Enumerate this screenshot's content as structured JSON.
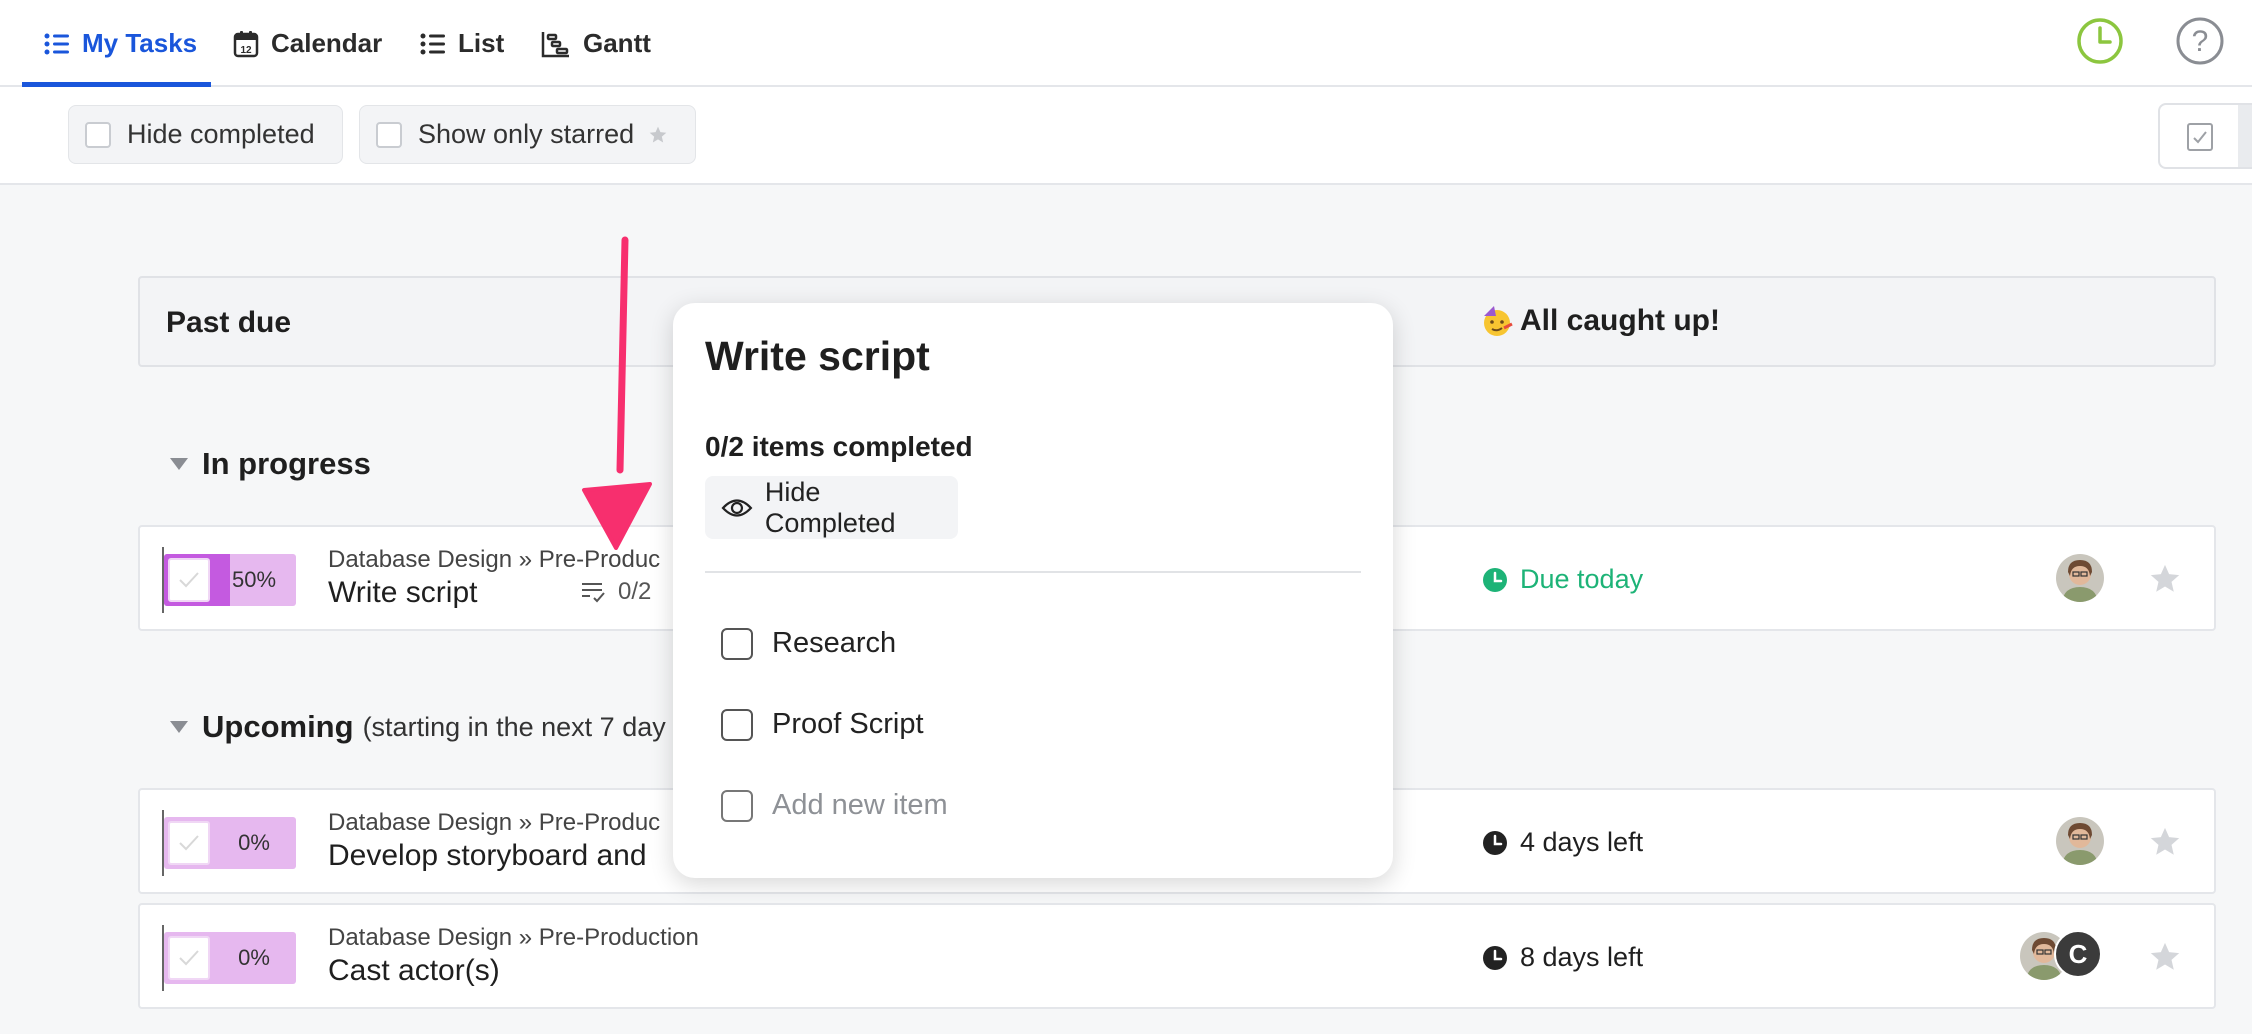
{
  "nav": {
    "tabs": [
      {
        "label": "My Tasks",
        "icon": "list-icon",
        "active": true
      },
      {
        "label": "Calendar",
        "icon": "calendar-icon"
      },
      {
        "label": "List",
        "icon": "list-icon"
      },
      {
        "label": "Gantt",
        "icon": "gantt-icon"
      }
    ],
    "calendar_icon_day": "12",
    "accent": "#1a56db",
    "clock_color": "#8cc63f"
  },
  "filters": {
    "hide_completed": "Hide completed",
    "show_only_starred": "Show only starred"
  },
  "past_due": {
    "title": "Past due",
    "status": "All caught up!"
  },
  "sections": {
    "in_progress": {
      "title": "In progress"
    },
    "upcoming": {
      "title": "Upcoming",
      "subtitle": "(starting in the next 7 day"
    }
  },
  "tasks": [
    {
      "progress": "50%",
      "progress_value": 50,
      "breadcrumb": "Database Design » Pre-Produc",
      "name": "Write script",
      "checklist": "0/2",
      "due": "Due today",
      "due_color": "#1db377"
    },
    {
      "progress": "0%",
      "progress_value": 0,
      "breadcrumb": "Database Design » Pre-Produc",
      "name": "Develop storyboard and",
      "due": "4 days left"
    },
    {
      "progress": "0%",
      "progress_value": 0,
      "breadcrumb": "Database Design » Pre-Production",
      "name": "Cast actor(s)",
      "due": "8 days left",
      "extra_avatar": "C"
    }
  ],
  "popup": {
    "title": "Write script",
    "count": "0/2 items completed",
    "hide_button": "Hide Completed",
    "items": [
      {
        "label": "Research",
        "checked": false
      },
      {
        "label": "Proof Script",
        "checked": false
      }
    ],
    "add_placeholder": "Add new item"
  },
  "annotation_arrow_color": "#f72f6e"
}
